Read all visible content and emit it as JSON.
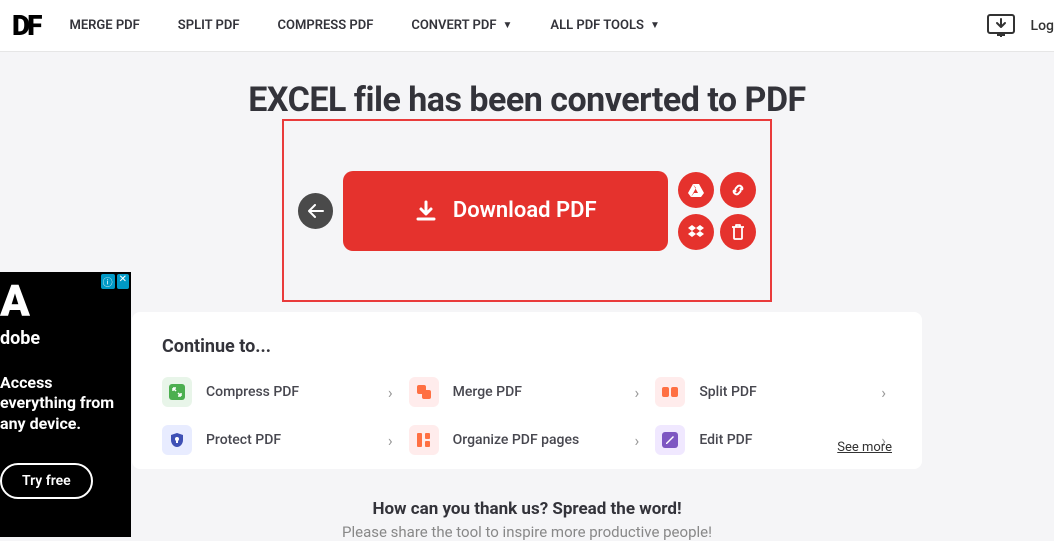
{
  "header": {
    "logo_text": "DF",
    "nav": {
      "merge": "MERGE PDF",
      "split": "SPLIT PDF",
      "compress": "COMPRESS PDF",
      "convert": "CONVERT PDF",
      "all": "ALL PDF TOOLS"
    },
    "login": "Log"
  },
  "main": {
    "title": "EXCEL file has been converted to PDF",
    "download_label": "Download PDF"
  },
  "continue": {
    "heading": "Continue to...",
    "see_more": "See more",
    "tools": {
      "compress": "Compress PDF",
      "merge": "Merge PDF",
      "split": "Split PDF",
      "protect": "Protect PDF",
      "organize": "Organize PDF pages",
      "edit": "Edit PDF"
    }
  },
  "share": {
    "title": "How can you thank us? Spread the word!",
    "subtitle": "Please share the tool to inspire more productive people!"
  },
  "ad": {
    "logo": "A",
    "brand": "dobe",
    "tagline_1": "Access",
    "tagline_2": "everything from",
    "tagline_3": "any device.",
    "cta": "Try free"
  }
}
